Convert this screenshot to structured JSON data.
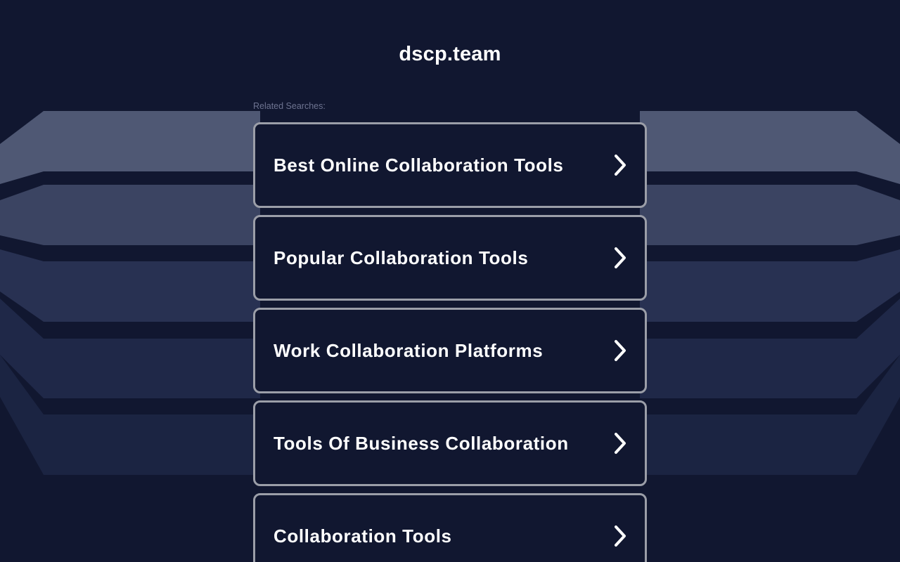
{
  "site": {
    "title": "dscp.team"
  },
  "related": {
    "label": "Related Searches:"
  },
  "links": [
    {
      "label": "Best Online Collaboration Tools",
      "icon": "chevron-right-icon"
    },
    {
      "label": "Popular Collaboration Tools",
      "icon": "chevron-right-icon"
    },
    {
      "label": "Work Collaboration Platforms",
      "icon": "chevron-right-icon"
    },
    {
      "label": "Tools Of Business Collaboration",
      "icon": "chevron-right-icon"
    },
    {
      "label": "Collaboration Tools",
      "icon": "chevron-right-icon"
    }
  ],
  "colors": {
    "background": "#111730",
    "card_border": "#9b9ea8",
    "text": "#ffffff",
    "muted_text": "#6d7390"
  }
}
